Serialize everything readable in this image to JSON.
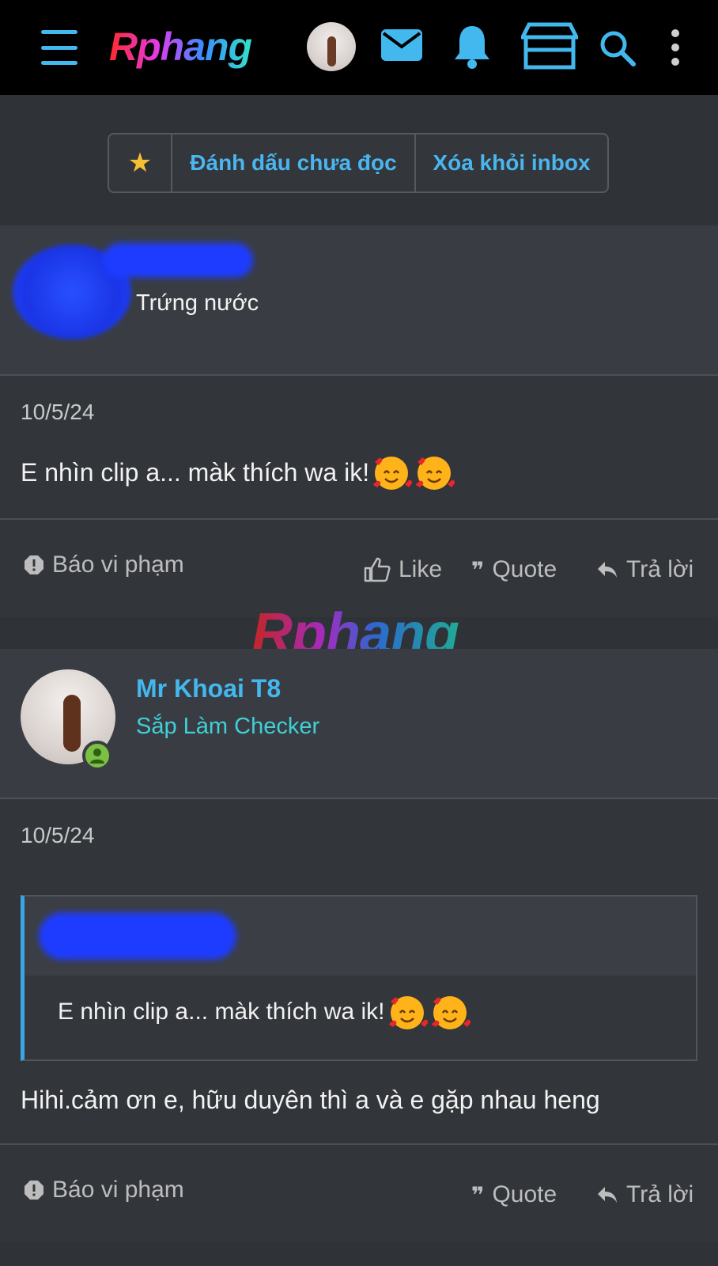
{
  "topbar": {
    "logo": "Rphang",
    "icons": [
      "menu-icon",
      "mail-icon",
      "bell-icon",
      "store-icon",
      "search-icon",
      "more-icon"
    ]
  },
  "actions": {
    "mark_unread": "Đánh dấu chưa đọc",
    "remove_inbox": "Xóa khỏi inbox"
  },
  "messages": [
    {
      "user_title": "Trứng nước",
      "date": "10/5/24",
      "text": "E nhìn clip a... màk thích wa ik!",
      "report": "Báo vi phạm",
      "like": "Like",
      "quote": "Quote",
      "reply": "Trả lời"
    },
    {
      "username": "Mr Khoai T8",
      "user_title": "Sắp Làm Checker",
      "date": "10/5/24",
      "quoted_text": "E nhìn clip a... màk thích wa ik!",
      "text": "Hihi.cảm ơn e, hữu duyên thì a và e gặp nhau heng",
      "report": "Báo vi phạm",
      "quote": "Quote",
      "reply": "Trả lời"
    }
  ],
  "watermark": "Rphang",
  "colors": {
    "accent": "#43b8ee",
    "username": "#43b8ee",
    "user_title_2": "#3fd0d8",
    "online": "#7bc043",
    "star": "#f6c033"
  }
}
